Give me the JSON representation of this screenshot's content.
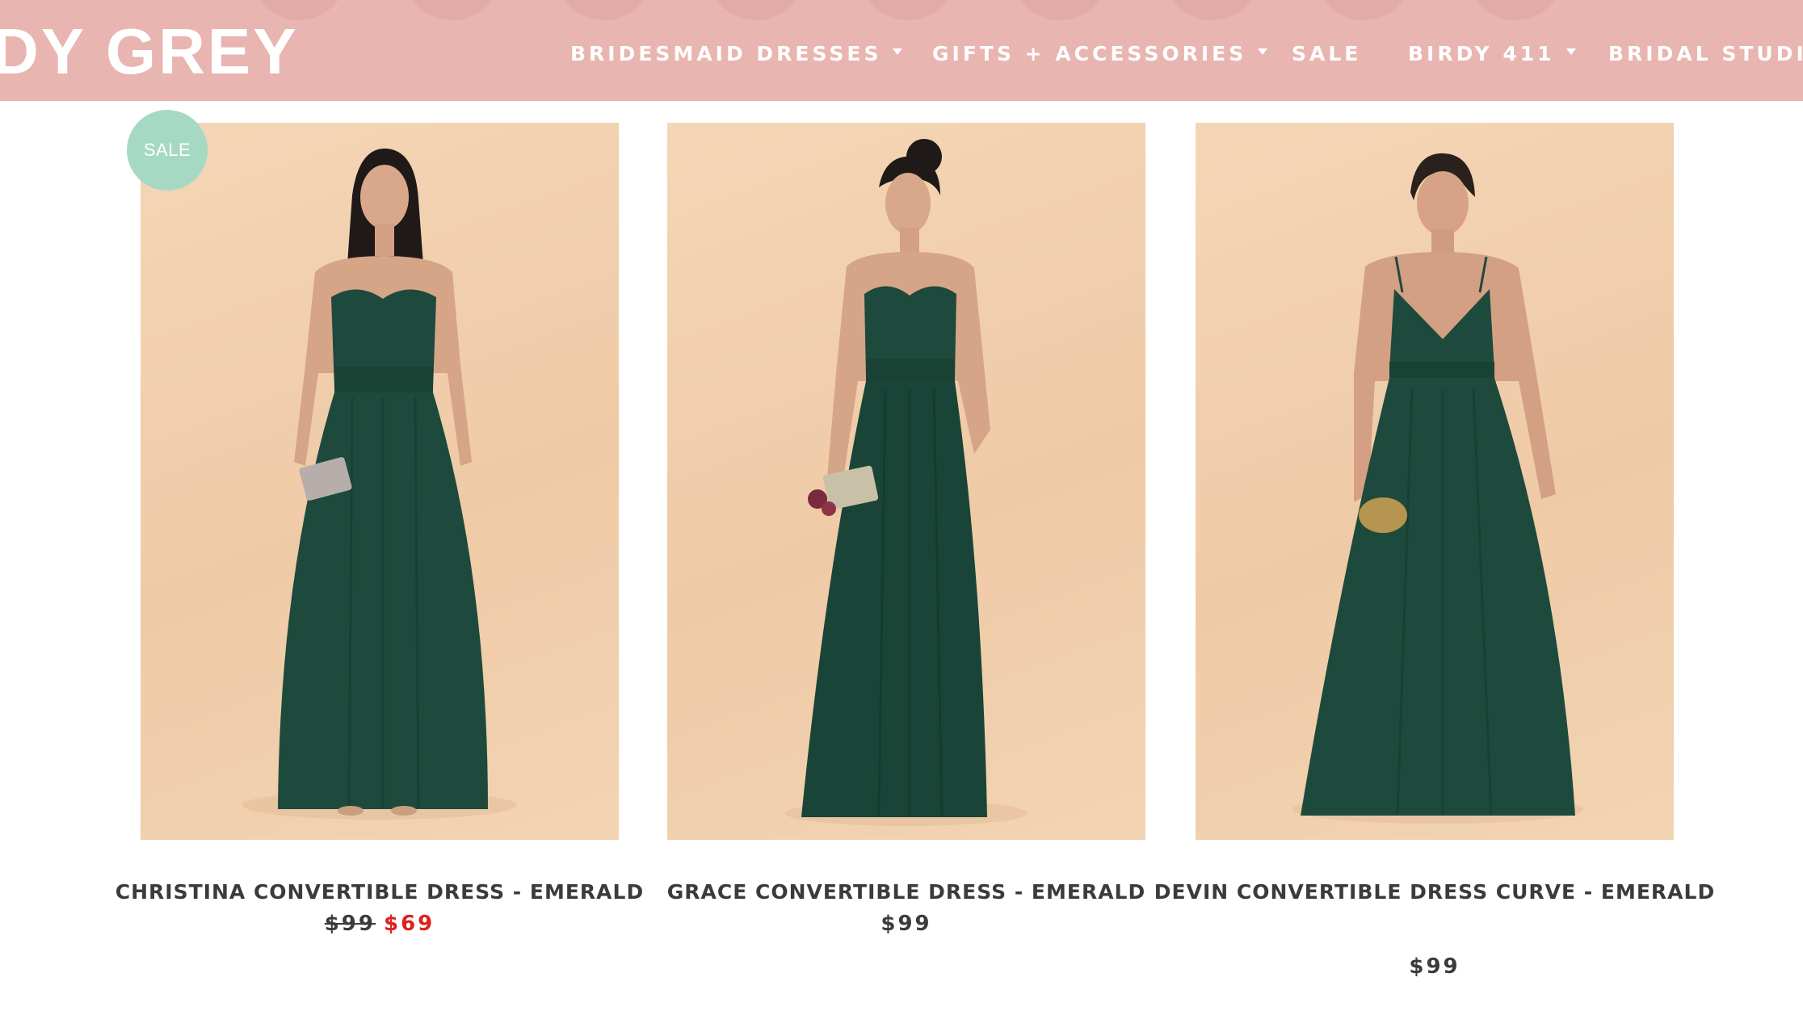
{
  "brand": {
    "logo_text": "DY GREY"
  },
  "nav": {
    "items": [
      {
        "label": "BRIDESMAID DRESSES",
        "has_dropdown": true
      },
      {
        "label": "GIFTS + ACCESSORIES",
        "has_dropdown": true
      },
      {
        "label": "SALE",
        "has_dropdown": false
      },
      {
        "label": "BIRDY 411",
        "has_dropdown": true
      },
      {
        "label": "BRIDAL STUDIO",
        "has_dropdown": false
      }
    ]
  },
  "products": [
    {
      "title": "CHRISTINA CONVERTIBLE DRESS - EMERALD",
      "badge": "SALE",
      "price_original": "$99",
      "price_sale": "$69",
      "sale_color": "#e0201b"
    },
    {
      "title": "GRACE CONVERTIBLE DRESS - EMERALD",
      "price": "$99"
    },
    {
      "title": "DEVIN CONVERTIBLE DRESS CURVE - EMERALD",
      "price": "$99"
    }
  ],
  "colors": {
    "header_bg": "#e8b5b1",
    "badge_bg": "#a6d9c3",
    "dress": "#1d4a3c",
    "text": "#3b3b3b"
  }
}
